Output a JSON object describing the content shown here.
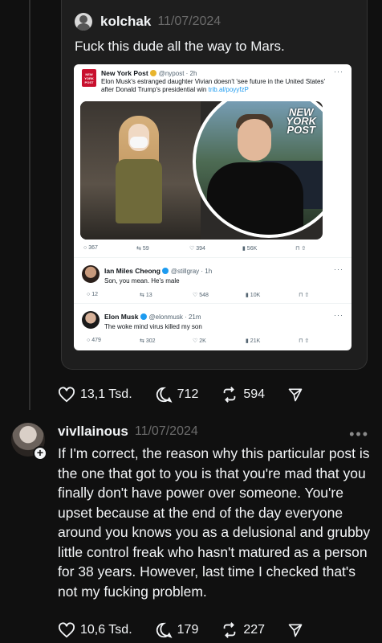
{
  "quote": {
    "username": "kolchak",
    "date": "11/07/2024",
    "text": "Fuck this dude all the way to Mars.",
    "embedded": {
      "logo_text": "NEW YORK POST",
      "post1": {
        "name": "New York Post",
        "handle": "@nypost · 2h",
        "text": "Elon Musk's estranged daughter Vivian doesn't 'see future in the United States' after Donald Trump's presidential win",
        "link": "trib.al/poyyfzP",
        "stamp": "NEW YORK POST",
        "stats": {
          "replies": "367",
          "reposts": "59",
          "likes": "394",
          "views": "56K"
        }
      },
      "post2": {
        "name": "Ian Miles Cheong",
        "handle": "@stillgray · 1h",
        "text": "Son, you mean. He's male",
        "stats": {
          "replies": "12",
          "reposts": "13",
          "likes": "548",
          "views": "10K"
        }
      },
      "post3": {
        "name": "Elon Musk",
        "handle": "@elonmusk · 21m",
        "text": "The woke mind virus killed my son",
        "stats": {
          "replies": "479",
          "reposts": "302",
          "likes": "2K",
          "views": "21K"
        }
      }
    }
  },
  "quote_actions": {
    "likes": "13,1 Tsd.",
    "comments": "712",
    "reposts": "594"
  },
  "reply": {
    "username": "vivllainous",
    "date": "11/07/2024",
    "more": "•••",
    "text": "If I'm correct, the reason why this particular post is the one that got to you is that you're mad that you finally don't have power over someone. You're upset because at the end of the day everyone around you knows you as a delusional and grubby little control freak who hasn't matured as a person for 38 years. However, last time I checked that's not my fucking problem."
  },
  "reply_actions": {
    "likes": "10,6 Tsd.",
    "comments": "179",
    "reposts": "227"
  },
  "icons": [
    "heart-icon",
    "comment-icon",
    "repost-icon",
    "share-icon",
    "plus-icon",
    "more-icon"
  ]
}
